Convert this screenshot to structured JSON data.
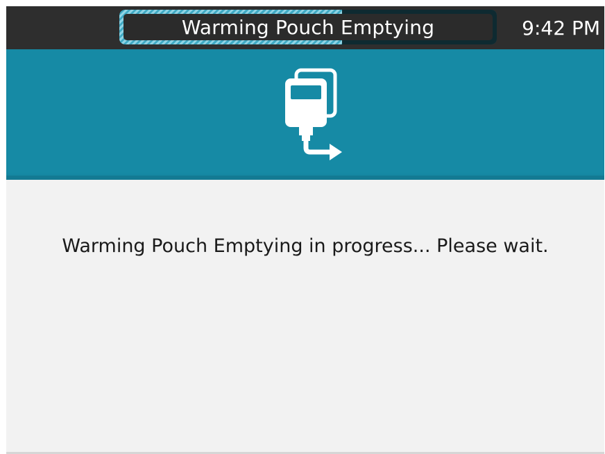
{
  "status_bar": {
    "title": "Warming Pouch Emptying",
    "time": "9:42 PM",
    "progress_fraction": 0.59
  },
  "header": {
    "icon": "warming-pouch-empty-icon"
  },
  "main": {
    "message": "Warming Pouch Emptying in progress... Please wait."
  },
  "colors": {
    "status_bar_bg": "#2e2e2e",
    "header_bg": "#168aa5",
    "screen_bg": "#f2f2f2",
    "progress_fill": "#8fd3e4"
  }
}
